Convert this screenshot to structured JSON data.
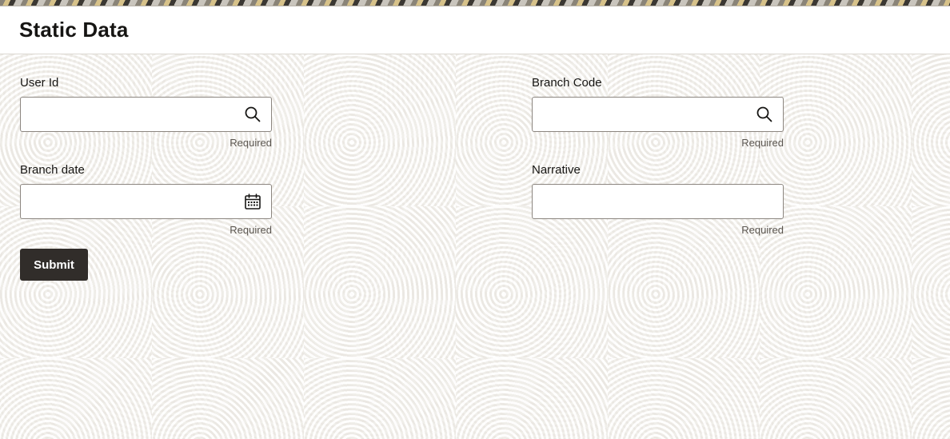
{
  "header": {
    "title": "Static Data"
  },
  "form": {
    "user_id": {
      "label": "User Id",
      "value": "",
      "helper": "Required",
      "icon": "search-icon"
    },
    "branch_code": {
      "label": "Branch Code",
      "value": "",
      "helper": "Required",
      "icon": "search-icon"
    },
    "branch_date": {
      "label": "Branch date",
      "value": "",
      "helper": "Required",
      "icon": "calendar-icon"
    },
    "narrative": {
      "label": "Narrative",
      "value": "",
      "helper": "Required"
    },
    "submit_label": "Submit"
  },
  "colors": {
    "primary_button": "#312d2a",
    "border": "#8c8680",
    "text": "#161513"
  }
}
